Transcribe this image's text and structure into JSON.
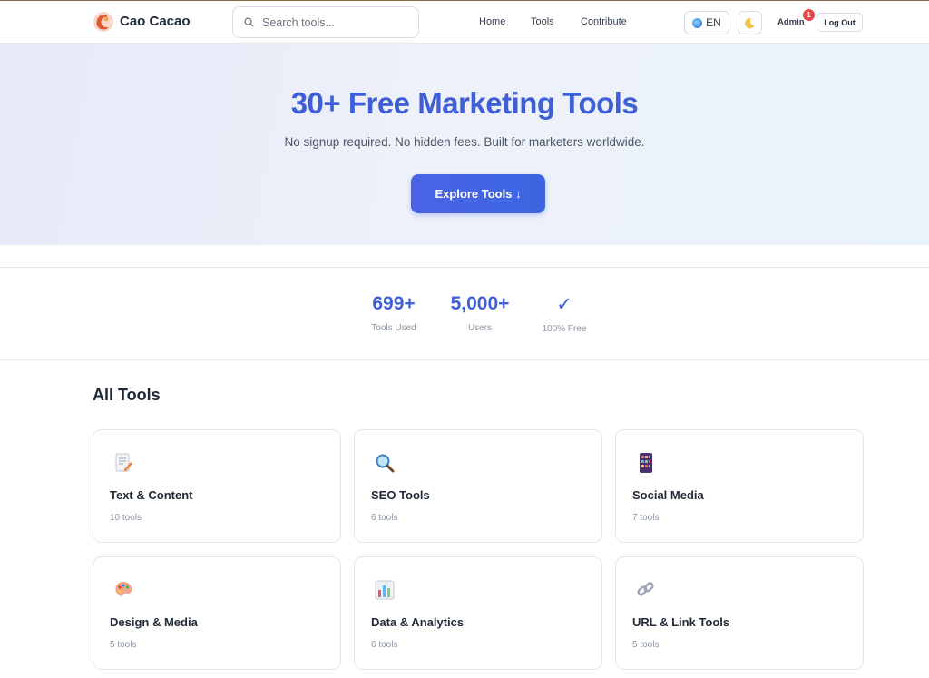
{
  "header": {
    "brand": "Cao Cacao",
    "search_placeholder": "Search tools...",
    "nav": [
      "Home",
      "Tools",
      "Contribute"
    ],
    "language": "EN",
    "user": "Admin",
    "notification_count": "1",
    "logout_label": "Log Out"
  },
  "hero": {
    "title": "30+ Free Marketing Tools",
    "subtitle": "No signup required. No hidden fees. Built for marketers worldwide.",
    "cta_label": "Explore Tools ↓"
  },
  "stats": [
    {
      "value": "699+",
      "label": "Tools Used"
    },
    {
      "value": "5,000+",
      "label": "Users"
    },
    {
      "value": "✓",
      "label": "100% Free"
    }
  ],
  "tools": {
    "heading": "All Tools",
    "categories": [
      {
        "name": "Text & Content",
        "count": "10 tools",
        "icon": "memo-icon"
      },
      {
        "name": "SEO Tools",
        "count": "6 tools",
        "icon": "magnifier-icon"
      },
      {
        "name": "Social Media",
        "count": "7 tools",
        "icon": "phone-icon"
      },
      {
        "name": "Design & Media",
        "count": "5 tools",
        "icon": "palette-icon"
      },
      {
        "name": "Data & Analytics",
        "count": "6 tools",
        "icon": "bar-chart-icon"
      },
      {
        "name": "URL & Link Tools",
        "count": "5 tools",
        "icon": "link-icon"
      }
    ]
  },
  "colors": {
    "accent": "#3f5fd6",
    "button": "#4a63e6",
    "badge": "#e5484d"
  }
}
